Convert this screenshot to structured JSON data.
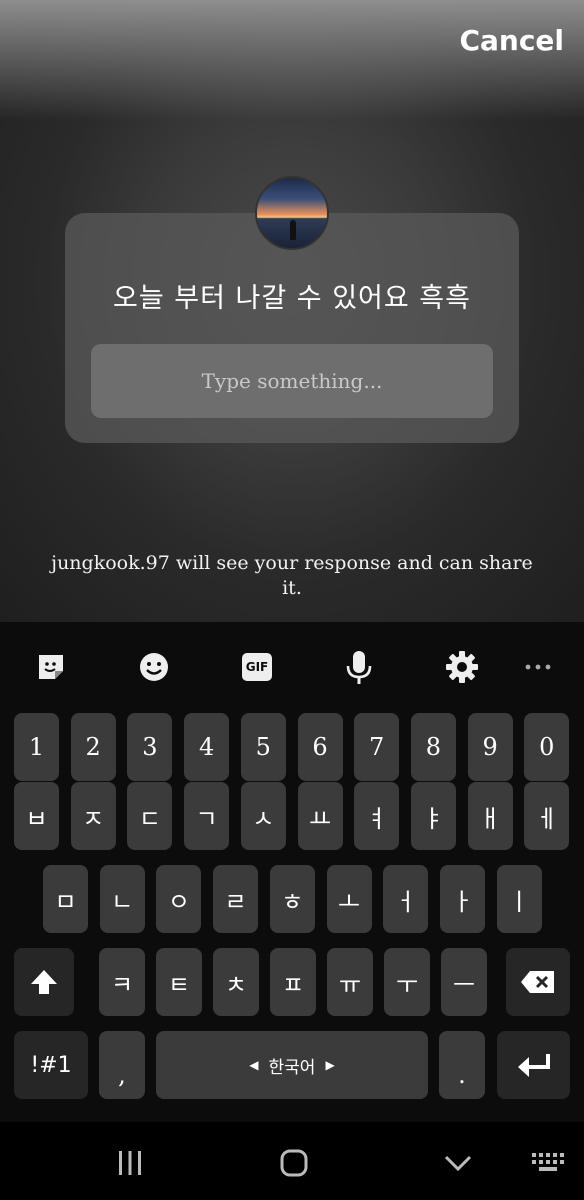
{
  "header": {
    "cancel_label": "Cancel"
  },
  "question_card": {
    "question": "오늘 부터 나갈 수 있어요 흑흑",
    "input_placeholder": "Type something...",
    "input_value": ""
  },
  "note": "jungkook.97 will see your response and can share it.",
  "keyboard": {
    "toolbar_icons": [
      "sticker-icon",
      "emoji-icon",
      "gif-icon",
      "microphone-icon",
      "settings-icon",
      "more-icon"
    ],
    "gif_label": "GIF",
    "rows": {
      "numbers": [
        "1",
        "2",
        "3",
        "4",
        "5",
        "6",
        "7",
        "8",
        "9",
        "0"
      ],
      "row1": [
        "ㅂ",
        "ㅈ",
        "ㄷ",
        "ㄱ",
        "ㅅ",
        "ㅛ",
        "ㅕ",
        "ㅑ",
        "ㅐ",
        "ㅔ"
      ],
      "row2": [
        "ㅁ",
        "ㄴ",
        "ㅇ",
        "ㄹ",
        "ㅎ",
        "ㅗ",
        "ㅓ",
        "ㅏ",
        "ㅣ"
      ],
      "row3": [
        "ㅋ",
        "ㅌ",
        "ㅊ",
        "ㅍ",
        "ㅠ",
        "ㅜ",
        "ㅡ"
      ]
    },
    "symbols_label": "!#1",
    "comma_label": ",",
    "space_label": "한국어",
    "period_label": "."
  }
}
